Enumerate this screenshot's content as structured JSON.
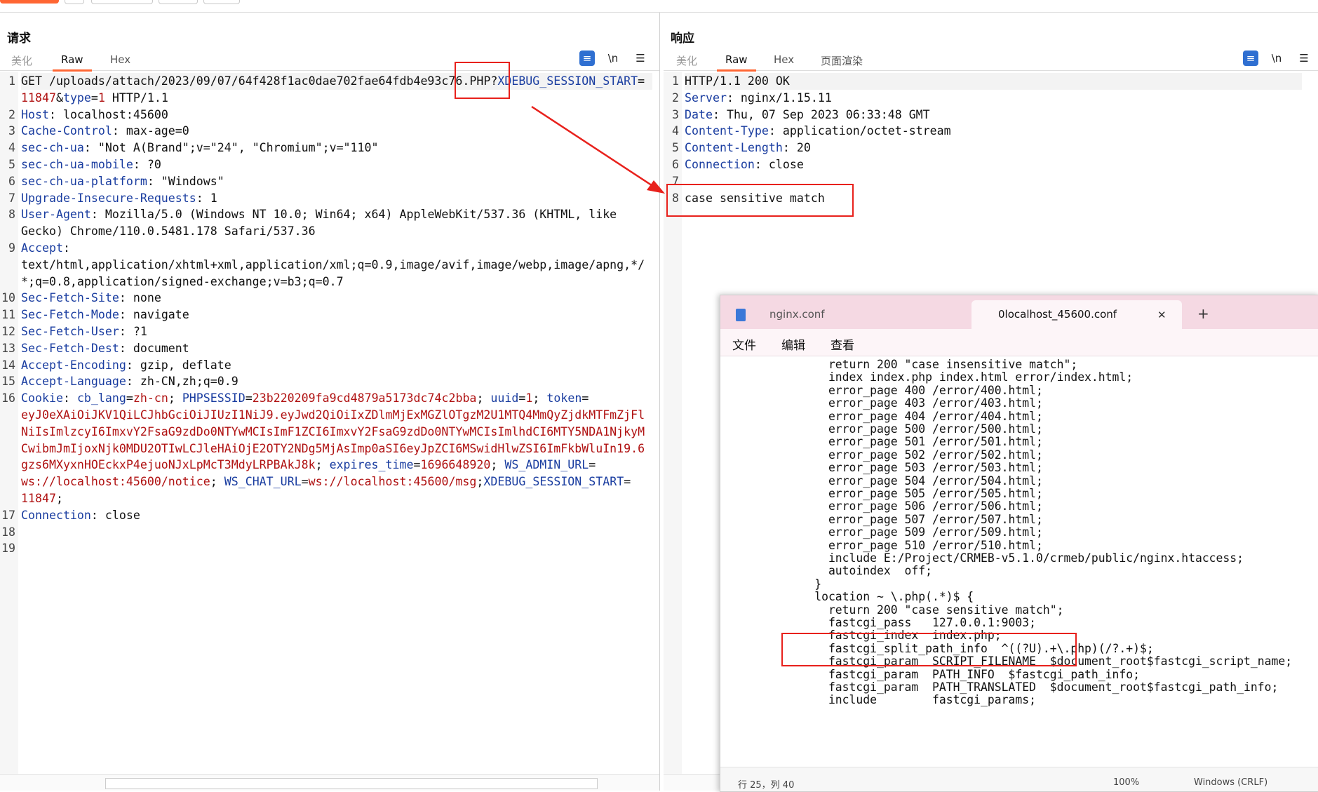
{
  "request": {
    "title": "请求",
    "tabs": [
      "美化",
      "Raw",
      "Hex"
    ],
    "icons": {
      "wrap": "≡",
      "newline": "\\n",
      "menu": "☰"
    },
    "lines": [
      {
        "n": "1",
        "segs": [
          [
            "v",
            "GET /uploads/attach/2023/09/07/64f428f1ac0dae702fae64fdb4e93c76.PHP?"
          ],
          [
            "k",
            "XDEBUG_SESSION_START"
          ],
          [
            "v",
            "="
          ]
        ]
      },
      {
        "n": "",
        "segs": [
          [
            "r",
            "11847"
          ],
          [
            "v",
            "&"
          ],
          [
            "k",
            "type"
          ],
          [
            "v",
            "="
          ],
          [
            "r",
            "1"
          ],
          [
            "v",
            " HTTP/1.1"
          ]
        ]
      },
      {
        "n": "2",
        "segs": [
          [
            "k",
            "Host"
          ],
          [
            "v",
            ": localhost:45600"
          ]
        ]
      },
      {
        "n": "3",
        "segs": [
          [
            "k",
            "Cache-Control"
          ],
          [
            "v",
            ": max-age=0"
          ]
        ]
      },
      {
        "n": "4",
        "segs": [
          [
            "k",
            "sec-ch-ua"
          ],
          [
            "v",
            ": \"Not A(Brand\";v=\"24\", \"Chromium\";v=\"110\""
          ]
        ]
      },
      {
        "n": "5",
        "segs": [
          [
            "k",
            "sec-ch-ua-mobile"
          ],
          [
            "v",
            ": ?0"
          ]
        ]
      },
      {
        "n": "6",
        "segs": [
          [
            "k",
            "sec-ch-ua-platform"
          ],
          [
            "v",
            ": \"Windows\""
          ]
        ]
      },
      {
        "n": "7",
        "segs": [
          [
            "k",
            "Upgrade-Insecure-Requests"
          ],
          [
            "v",
            ": 1"
          ]
        ]
      },
      {
        "n": "8",
        "segs": [
          [
            "k",
            "User-Agent"
          ],
          [
            "v",
            ": Mozilla/5.0 (Windows NT 10.0; Win64; x64) AppleWebKit/537.36 (KHTML, like"
          ]
        ]
      },
      {
        "n": "",
        "segs": [
          [
            "v",
            "Gecko) Chrome/110.0.5481.178 Safari/537.36"
          ]
        ]
      },
      {
        "n": "9",
        "segs": [
          [
            "k",
            "Accept"
          ],
          [
            "v",
            ":"
          ]
        ]
      },
      {
        "n": "",
        "segs": [
          [
            "v",
            "text/html,application/xhtml+xml,application/xml;q=0.9,image/avif,image/webp,image/apng,*/"
          ]
        ]
      },
      {
        "n": "",
        "segs": [
          [
            "v",
            "*;q=0.8,application/signed-exchange;v=b3;q=0.7"
          ]
        ]
      },
      {
        "n": "10",
        "segs": [
          [
            "k",
            "Sec-Fetch-Site"
          ],
          [
            "v",
            ": none"
          ]
        ]
      },
      {
        "n": "11",
        "segs": [
          [
            "k",
            "Sec-Fetch-Mode"
          ],
          [
            "v",
            ": navigate"
          ]
        ]
      },
      {
        "n": "12",
        "segs": [
          [
            "k",
            "Sec-Fetch-User"
          ],
          [
            "v",
            ": ?1"
          ]
        ]
      },
      {
        "n": "13",
        "segs": [
          [
            "k",
            "Sec-Fetch-Dest"
          ],
          [
            "v",
            ": document"
          ]
        ]
      },
      {
        "n": "14",
        "segs": [
          [
            "k",
            "Accept-Encoding"
          ],
          [
            "v",
            ": gzip, deflate"
          ]
        ]
      },
      {
        "n": "15",
        "segs": [
          [
            "k",
            "Accept-Language"
          ],
          [
            "v",
            ": zh-CN,zh;q=0.9"
          ]
        ]
      },
      {
        "n": "16",
        "segs": [
          [
            "k",
            "Cookie"
          ],
          [
            "v",
            ": "
          ],
          [
            "k",
            "cb_lang"
          ],
          [
            "v",
            "="
          ],
          [
            "r",
            "zh-cn"
          ],
          [
            "v",
            "; "
          ],
          [
            "k",
            "PHPSESSID"
          ],
          [
            "v",
            "="
          ],
          [
            "r",
            "23b220209fa9cd4879a5173dc74c2bba"
          ],
          [
            "v",
            "; "
          ],
          [
            "k",
            "uuid"
          ],
          [
            "v",
            "="
          ],
          [
            "r",
            "1"
          ],
          [
            "v",
            "; "
          ],
          [
            "k",
            "token"
          ],
          [
            "v",
            "="
          ]
        ]
      },
      {
        "n": "",
        "segs": [
          [
            "r",
            "eyJ0eXAiOiJKV1QiLCJhbGciOiJIUzI1NiJ9.eyJwd2QiOiIxZDlmMjExMGZlOTgzM2U1MTQ4MmQyZjdkMTFmZjFl"
          ]
        ]
      },
      {
        "n": "",
        "segs": [
          [
            "r",
            "NiIsImlzcyI6ImxvY2FsaG9zdDo0NTYwMCIsImF1ZCI6ImxvY2FsaG9zdDo0NTYwMCIsImlhdCI6MTY5NDA1NjkyM"
          ]
        ]
      },
      {
        "n": "",
        "segs": [
          [
            "r",
            "CwibmJmIjoxNjk0MDU2OTIwLCJleHAiOjE2OTY2NDg5MjAsImp0aSI6eyJpZCI6MSwidHlwZSI6ImFkbWluIn19.6"
          ]
        ]
      },
      {
        "n": "",
        "segs": [
          [
            "r",
            "gzs6MXyxnHOEckxP4ejuoNJxLpMcT3MdyLRPBAkJ8k"
          ],
          [
            "v",
            "; "
          ],
          [
            "k",
            "expires_time"
          ],
          [
            "v",
            "="
          ],
          [
            "r",
            "1696648920"
          ],
          [
            "v",
            "; "
          ],
          [
            "k",
            "WS_ADMIN_URL"
          ],
          [
            "v",
            "="
          ]
        ]
      },
      {
        "n": "",
        "segs": [
          [
            "r",
            "ws://localhost:45600/notice"
          ],
          [
            "v",
            "; "
          ],
          [
            "k",
            "WS_CHAT_URL"
          ],
          [
            "v",
            "="
          ],
          [
            "r",
            "ws://localhost:45600/msg"
          ],
          [
            "v",
            ";"
          ],
          [
            "k",
            "XDEBUG_SESSION_START"
          ],
          [
            "v",
            "="
          ]
        ]
      },
      {
        "n": "",
        "segs": [
          [
            "r",
            "11847"
          ],
          [
            "v",
            ";"
          ]
        ]
      },
      {
        "n": "17",
        "segs": [
          [
            "k",
            "Connection"
          ],
          [
            "v",
            ": close"
          ]
        ]
      },
      {
        "n": "18",
        "segs": []
      },
      {
        "n": "19",
        "segs": []
      }
    ]
  },
  "response": {
    "title": "响应",
    "tabs": [
      "美化",
      "Raw",
      "Hex",
      "页面渲染"
    ],
    "icons": {
      "wrap": "≡",
      "newline": "\\n",
      "menu": "☰"
    },
    "lines": [
      {
        "n": "1",
        "segs": [
          [
            "v",
            "HTTP/1.1 200 OK"
          ]
        ]
      },
      {
        "n": "2",
        "segs": [
          [
            "k",
            "Server"
          ],
          [
            "v",
            ": nginx/1.15.11"
          ]
        ]
      },
      {
        "n": "3",
        "segs": [
          [
            "k",
            "Date"
          ],
          [
            "v",
            ": Thu, 07 Sep 2023 06:33:48 GMT"
          ]
        ]
      },
      {
        "n": "4",
        "segs": [
          [
            "k",
            "Content-Type"
          ],
          [
            "v",
            ": application/octet-stream"
          ]
        ]
      },
      {
        "n": "5",
        "segs": [
          [
            "k",
            "Content-Length"
          ],
          [
            "v",
            ": 20"
          ]
        ]
      },
      {
        "n": "6",
        "segs": [
          [
            "k",
            "Connection"
          ],
          [
            "v",
            ": close"
          ]
        ]
      },
      {
        "n": "7",
        "segs": []
      },
      {
        "n": "8",
        "segs": [
          [
            "v",
            "case sensitive match"
          ]
        ]
      }
    ]
  },
  "notepad": {
    "tabs": [
      "nginx.conf",
      "0localhost_45600.conf"
    ],
    "close": "✕",
    "add": "+",
    "menu": [
      "文件",
      "编辑",
      "查看"
    ],
    "lines": [
      "        return 200 \"case insensitive match\";",
      "        index index.php index.html error/index.html;",
      "        error_page 400 /error/400.html;",
      "        error_page 403 /error/403.html;",
      "        error_page 404 /error/404.html;",
      "        error_page 500 /error/500.html;",
      "        error_page 501 /error/501.html;",
      "        error_page 502 /error/502.html;",
      "        error_page 503 /error/503.html;",
      "        error_page 504 /error/504.html;",
      "        error_page 505 /error/505.html;",
      "        error_page 506 /error/506.html;",
      "        error_page 507 /error/507.html;",
      "        error_page 509 /error/509.html;",
      "        error_page 510 /error/510.html;",
      "        include E:/Project/CRMEB-v5.1.0/crmeb/public/nginx.htaccess;",
      "        autoindex  off;",
      "      }",
      "      location ~ \\.php(.*)$ {",
      "        return 200 \"case sensitive match\";",
      "        fastcgi_pass   127.0.0.1:9003;",
      "        fastcgi_index  index.php;",
      "        fastcgi_split_path_info  ^((?U).+\\.php)(/?.+)$;",
      "        fastcgi_param  SCRIPT_FILENAME  $document_root$fastcgi_script_name;",
      "        fastcgi_param  PATH_INFO  $fastcgi_path_info;",
      "        fastcgi_param  PATH_TRANSLATED  $document_root$fastcgi_path_info;",
      "        include        fastcgi_params;"
    ],
    "status": {
      "pos": "行 25，列 40",
      "zoom": "100%",
      "eol": "Windows (CRLF)"
    }
  },
  "colors": {
    "accent": "#ff6633",
    "header_key": "#1a3da0",
    "value_red": "#b01212",
    "annotation": "#e8211c"
  }
}
